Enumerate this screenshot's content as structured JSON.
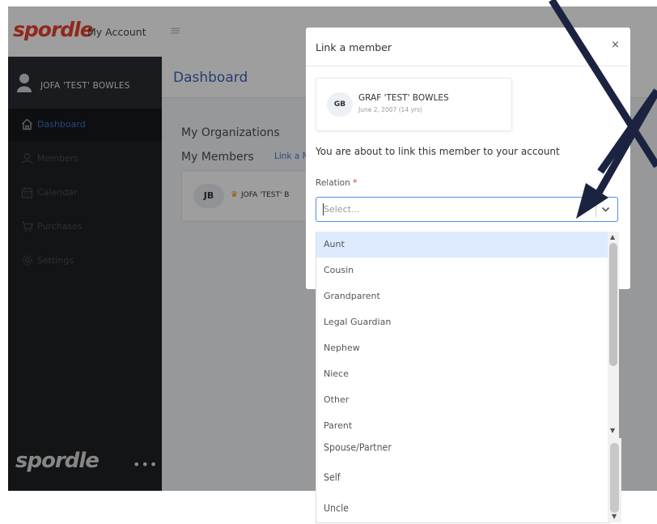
{
  "header": {
    "brand": "spordle",
    "product": "My Account",
    "menu_icon": "≡"
  },
  "sidebar": {
    "user_name": "JOFA 'TEST' BOWLES",
    "items": [
      {
        "label": "Dashboard",
        "icon": "home-icon",
        "active": true
      },
      {
        "label": "Members",
        "icon": "user-icon",
        "active": false
      },
      {
        "label": "Calendar",
        "icon": "calendar-icon",
        "active": false
      },
      {
        "label": "Purchases",
        "icon": "cart-icon",
        "active": false
      },
      {
        "label": "Settings",
        "icon": "gear-icon",
        "active": false
      }
    ],
    "bottom_brand": "spordle",
    "more": "•••"
  },
  "main": {
    "title": "Dashboard",
    "my_organizations": "My Organizations",
    "my_members": "My Members",
    "link_partial": "Link a M",
    "member_card": {
      "initials": "JB",
      "name": "JOFA 'TEST' B"
    }
  },
  "modal": {
    "title": "Link a member",
    "close": "×",
    "member": {
      "initials": "GB",
      "name": "GRAF 'TEST' BOWLES",
      "dob": "June 2, 2007 (14 yrs)"
    },
    "text": "You are about to link this member to your account",
    "relation_label": "Relation",
    "required_mark": "*",
    "select_placeholder": "Select..."
  },
  "dropdown": {
    "options": [
      "Aunt",
      "Cousin",
      "Grandparent",
      "Legal Guardian",
      "Nephew",
      "Niece",
      "Other",
      "Parent"
    ],
    "highlighted": "Aunt",
    "extended_options": [
      "Spouse/Partner",
      "Self",
      "Uncle"
    ]
  },
  "colors": {
    "brand": "#e8412c",
    "sidebar_bg": "#1f2125",
    "accent": "#3f62b6",
    "highlight": "#deebff",
    "annotation": "#1b2340"
  }
}
